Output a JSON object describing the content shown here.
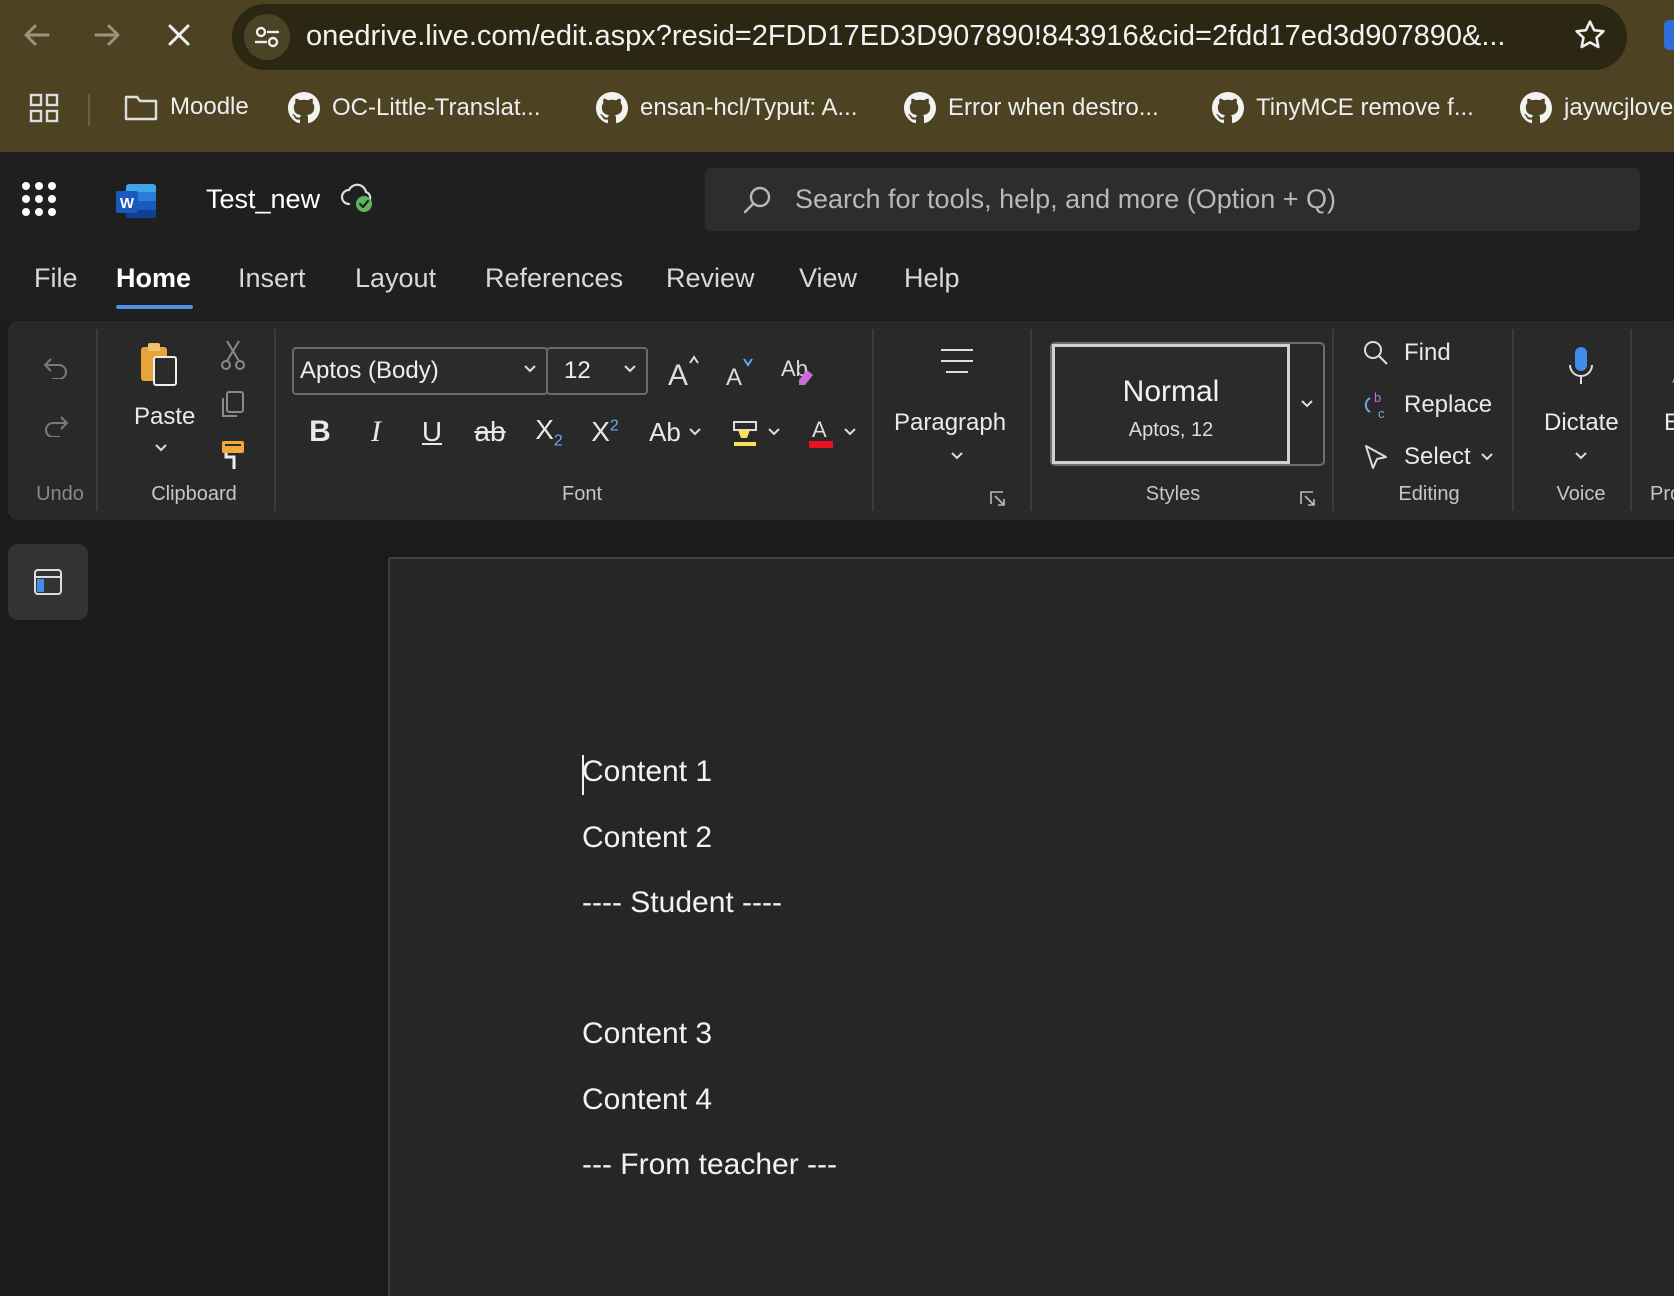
{
  "browser": {
    "url": "onedrive.live.com/edit.aspx?resid=2FDD17ED3D907890!843916&cid=2fdd17ed3d907890&...",
    "bookmarks": [
      {
        "label": "Moodle",
        "icon": "folder-icon"
      },
      {
        "label": "OC-Little-Translat...",
        "icon": "github-icon"
      },
      {
        "label": "ensan-hcl/Typut: A...",
        "icon": "github-icon"
      },
      {
        "label": "Error when destro...",
        "icon": "github-icon"
      },
      {
        "label": "TinyMCE remove f...",
        "icon": "github-icon"
      },
      {
        "label": "jaywcjlove",
        "icon": "github-icon"
      }
    ]
  },
  "app": {
    "doc_title": "Test_new",
    "search_placeholder": "Search for tools, help, and more (Option + Q)"
  },
  "tabs": [
    "File",
    "Home",
    "Insert",
    "Layout",
    "References",
    "Review",
    "View",
    "Help"
  ],
  "ribbon": {
    "groups": {
      "undo": "Undo",
      "clipboard": "Clipboard",
      "font": "Font",
      "styles": "Styles",
      "editing": "Editing",
      "voice": "Voice",
      "proofing": "Pro"
    },
    "paste_label": "Paste",
    "font_name": "Aptos (Body)",
    "font_size": "12",
    "paragraph_label": "Paragraph",
    "style": {
      "name": "Normal",
      "detail": "Aptos, 12"
    },
    "find_label": "Find",
    "replace_label": "Replace",
    "select_label": "Select",
    "dictate_label": "Dictate",
    "editor_label": "Ec"
  },
  "document": {
    "paragraphs": [
      "Content 1",
      "Content 2",
      "---- Student ----",
      "Content 3",
      "Content 4",
      "--- From teacher ---"
    ]
  },
  "colors": {
    "chrome_bg": "#4d4322",
    "app_bg": "#1b1b1b",
    "accent": "#4f8fe8",
    "font_color_red": "#e81123"
  }
}
